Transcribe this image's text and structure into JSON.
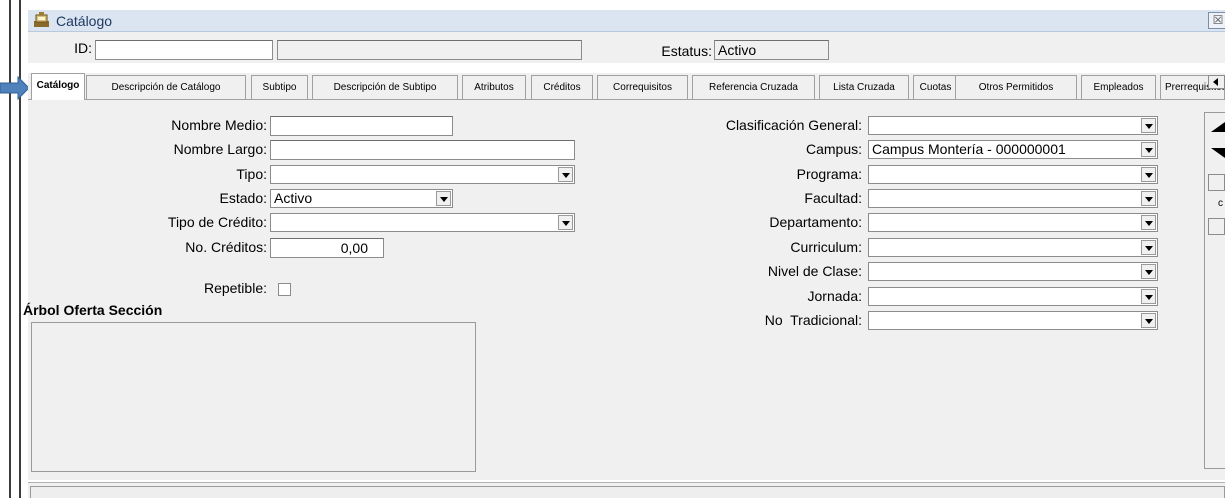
{
  "window": {
    "title": "Catálogo",
    "close_glyph": "☒"
  },
  "header": {
    "id_label": "ID:",
    "id_value": "",
    "id_desc": "",
    "status_label": "Estatus:",
    "status_value": "Activo"
  },
  "tabs": [
    "Catálogo",
    "Descripción de Catálogo",
    "Subtipo",
    "Descripción de Subtipo",
    "Atributos",
    "Créditos",
    "Correquisitos",
    "Referencia Cruzada",
    "Lista Cruzada",
    "Cuotas",
    "Otros Permitidos",
    "Empleados",
    "Prerrequisitos"
  ],
  "left_form": {
    "nombre_medio_label": "Nombre Medio:",
    "nombre_medio_value": "",
    "nombre_largo_label": "Nombre Largo:",
    "nombre_largo_value": "",
    "tipo_label": "Tipo:",
    "tipo_value": "",
    "estado_label": "Estado:",
    "estado_value": "Activo",
    "tipo_credito_label": "Tipo de Crédito:",
    "tipo_credito_value": "",
    "no_creditos_label": "No. Créditos:",
    "no_creditos_value": "0,00",
    "repetible_label": "Repetible:",
    "repetible_checked": false
  },
  "tree_section": {
    "title": "Árbol Oferta Sección"
  },
  "right_form": {
    "clasificacion_label": "Clasificación General:",
    "clasificacion_value": "",
    "campus_label": "Campus:",
    "campus_value": "Campus Montería - 000000001",
    "programa_label": "Programa:",
    "programa_value": "",
    "facultad_label": "Facultad:",
    "facultad_value": "",
    "departamento_label": "Departamento:",
    "departamento_value": "",
    "curriculum_label": "Curriculum:",
    "curriculum_value": "",
    "nivel_label": "Nivel de Clase:",
    "nivel_value": "",
    "jornada_label": "Jornada:",
    "jornada_value": "",
    "no_tradicional_label": "No  Tradicional:",
    "no_tradicional_value": ""
  },
  "right_panel": {
    "small_letter": "c"
  },
  "colors": {
    "arrow": "#4f81bd",
    "titlebar": "#dbe5f1",
    "panel": "#f0f0f0"
  }
}
